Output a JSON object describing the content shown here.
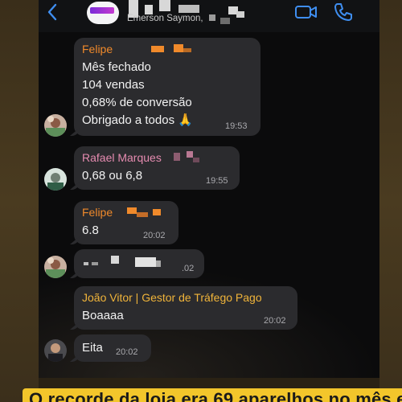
{
  "header": {
    "subtitle": "Emerson Saymon,",
    "back_icon": "chevron-left-icon",
    "video_icon": "video-camera-icon",
    "call_icon": "phone-icon"
  },
  "messages": [
    {
      "sender": "Felipe",
      "sender_color": "#f08a2b",
      "lines": [
        "Mês fechado",
        "104 vendas",
        "0,68% de conversão",
        "Obrigado a todos 🙏"
      ],
      "time": "19:53"
    },
    {
      "sender": "Rafael Marques",
      "sender_color": "#e58bb0",
      "lines": [
        "0,68 ou 6,8"
      ],
      "time": "19:55"
    },
    {
      "sender": "Felipe",
      "sender_color": "#f08a2b",
      "lines": [
        "6.8"
      ],
      "time": "20:02"
    },
    {
      "sender": "",
      "lines": [],
      "time": ".02"
    },
    {
      "sender": "João Vitor | Gestor de Tráfego Pago",
      "sender_color": "#f0b43a",
      "lines": [
        "Boaaaa"
      ],
      "time": "20:02"
    },
    {
      "sender": "",
      "lines": [
        "Eita"
      ],
      "time": "20:02"
    }
  ],
  "caption": {
    "text": "O recorde da loja era 69 aparelhos no mês e",
    "background": "#f3c62b"
  },
  "colors": {
    "accent": "#3f8ef0",
    "bubble": "#2b2b2e",
    "chat_background": "#0b0b0c"
  }
}
